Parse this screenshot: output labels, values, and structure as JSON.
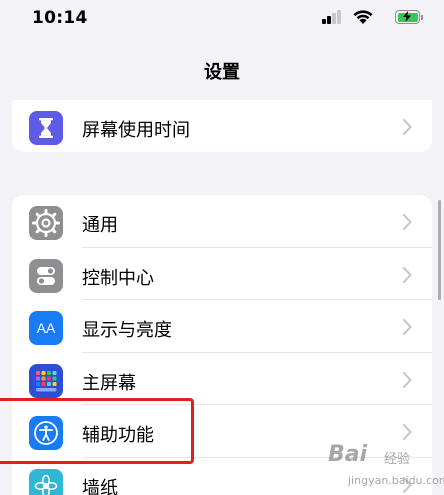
{
  "status": {
    "time": "10:14"
  },
  "nav": {
    "title": "设置"
  },
  "group1": [
    {
      "label": "屏幕使用时间",
      "icon": "hourglass-icon",
      "color": "#5e5ce6"
    }
  ],
  "group2": [
    {
      "label": "通用",
      "icon": "gear-icon",
      "color": "#8e8e93"
    },
    {
      "label": "控制中心",
      "icon": "toggles-icon",
      "color": "#8e8e93"
    },
    {
      "label": "显示与亮度",
      "icon": "aa-icon",
      "icon_text": "AA",
      "color": "#1a7cf4"
    },
    {
      "label": "主屏幕",
      "icon": "home-grid-icon",
      "color": "#2d4fd6"
    },
    {
      "label": "辅助功能",
      "icon": "accessibility-icon",
      "color": "#1a7cf4"
    },
    {
      "label": "墙纸",
      "icon": "flower-icon",
      "color": "#2fb8d6"
    }
  ],
  "watermark": {
    "brand": "Bai",
    "sub": "经验",
    "url": "jingyan.baidu.com"
  }
}
